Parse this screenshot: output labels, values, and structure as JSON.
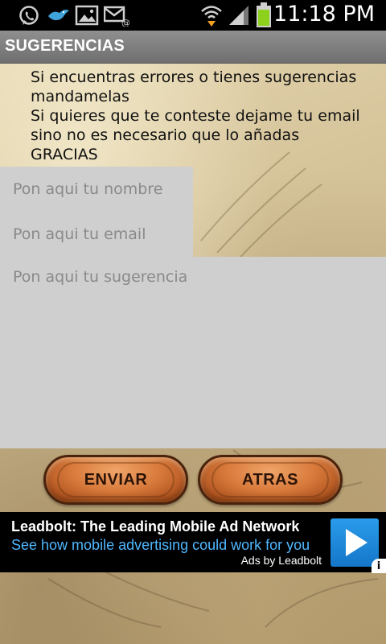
{
  "status_bar": {
    "time": "11:18 PM",
    "icons": [
      "whatsapp-icon",
      "bird-app-icon",
      "gallery-icon",
      "email-icon",
      "wifi-icon",
      "signal-icon",
      "battery-icon"
    ]
  },
  "title_bar": {
    "title": "SUGERENCIAS"
  },
  "message": {
    "lines": [
      "Si encuentras errores o tienes sugerencias",
      "mandamelas",
      "Si quieres que te conteste dejame tu email",
      "sino no es necesario que lo añadas",
      "GRACIAS"
    ]
  },
  "form": {
    "name_placeholder": "Pon aqui tu nombre",
    "email_placeholder": "Pon aqui tu email",
    "suggestion_placeholder": "Pon aqui tu sugerencia",
    "name_value": "",
    "email_value": "",
    "suggestion_value": ""
  },
  "buttons": {
    "send_label": "ENVIAR",
    "back_label": "ATRAS"
  },
  "ad": {
    "title": "Leadbolt: The Leading Mobile Ad Network",
    "subtitle": "See how mobile advertising could work for you",
    "attribution": "Ads by Leadbolt",
    "info_glyph": "i"
  },
  "colors": {
    "status_bar_bg": "#000000",
    "title_bar_bg": "#7f7f7f",
    "field_bg": "#cfcfcf",
    "button_wood": "#d87a3b",
    "ad_subtitle": "#4fb7ff",
    "ad_play": "#1e88d8",
    "battery": "#8dd11d"
  }
}
